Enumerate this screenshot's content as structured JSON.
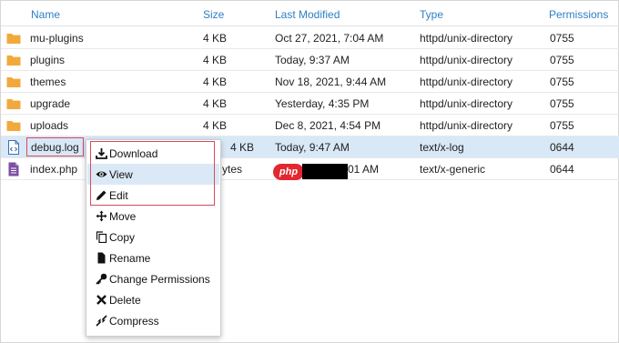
{
  "columns": {
    "name": "Name",
    "size": "Size",
    "modified": "Last Modified",
    "type": "Type",
    "permissions": "Permissions"
  },
  "files": [
    {
      "name": "mu-plugins",
      "size": "4 KB",
      "modified": "Oct 27, 2021, 7:04 AM",
      "type": "httpd/unix-directory",
      "permissions": "0755",
      "icon": "folder-icon"
    },
    {
      "name": "plugins",
      "size": "4 KB",
      "modified": "Today, 9:37 AM",
      "type": "httpd/unix-directory",
      "permissions": "0755",
      "icon": "folder-icon"
    },
    {
      "name": "themes",
      "size": "4 KB",
      "modified": "Nov 18, 2021, 9:44 AM",
      "type": "httpd/unix-directory",
      "permissions": "0755",
      "icon": "folder-icon"
    },
    {
      "name": "upgrade",
      "size": "4 KB",
      "modified": "Yesterday, 4:35 PM",
      "type": "httpd/unix-directory",
      "permissions": "0755",
      "icon": "folder-icon"
    },
    {
      "name": "uploads",
      "size": "4 KB",
      "modified": "Dec 8, 2021, 4:54 PM",
      "type": "httpd/unix-directory",
      "permissions": "0755",
      "icon": "folder-icon"
    },
    {
      "name": "debug.log",
      "size": "4 KB",
      "modified": "Today, 9:47 AM",
      "type": "text/x-log",
      "permissions": "0644",
      "icon": "code-file-icon",
      "selected": true
    },
    {
      "name": "index.php",
      "size": "ytes",
      "modified": "01 AM",
      "type": "text/x-generic",
      "permissions": "0644",
      "icon": "php-file-icon"
    }
  ],
  "php_badge": "php",
  "context_menu": [
    {
      "label": "Download",
      "icon": "download-icon"
    },
    {
      "label": "View",
      "icon": "eye-icon"
    },
    {
      "label": "Edit",
      "icon": "pencil-icon"
    },
    {
      "label": "Move",
      "icon": "move-icon"
    },
    {
      "label": "Copy",
      "icon": "copy-icon"
    },
    {
      "label": "Rename",
      "icon": "file-icon"
    },
    {
      "label": "Change Permissions",
      "icon": "key-icon"
    },
    {
      "label": "Delete",
      "icon": "x-icon"
    },
    {
      "label": "Compress",
      "icon": "compress-icon"
    }
  ],
  "colors": {
    "header_link": "#2f7fc4",
    "folder": "#f2a93b",
    "selected_row": "#d8e8f7",
    "highlight_box": "#d84a5a",
    "php_badge": "#e3262f"
  }
}
